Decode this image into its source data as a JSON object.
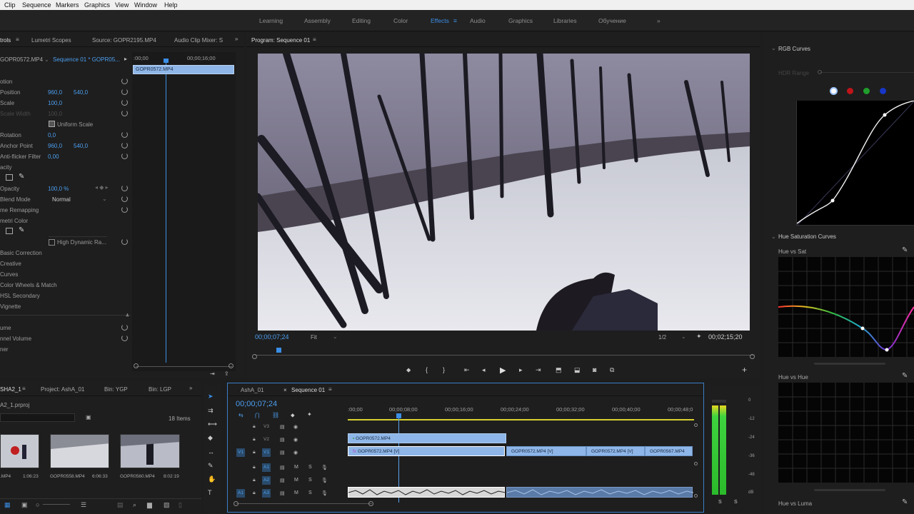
{
  "menu": [
    "Clip",
    "Sequence",
    "Markers",
    "Graphics",
    "View",
    "Window",
    "Help"
  ],
  "workspaces": [
    "Learning",
    "Assembly",
    "Editing",
    "Color",
    "Effects",
    "Audio",
    "Graphics",
    "Libraries",
    "Обучение"
  ],
  "active_workspace": "Effects",
  "overflow_glyph": "»",
  "effect_controls": {
    "tab": "trols",
    "tabs": [
      "Lumetri Scopes",
      "Source: GOPR2195.MP4",
      "Audio Clip Mixer: S"
    ],
    "source": "GOPR0572.MP4",
    "sequence_label": "Sequence 01 * GOPR05...",
    "time_start": ":00;00",
    "time_mid": "00;00;16;00",
    "clip_name": "GOPR0572.MP4",
    "rows": [
      {
        "label": "otion",
        "v1": "",
        "v2": ""
      },
      {
        "label": "Position",
        "v1": "960,0",
        "v2": "540,0"
      },
      {
        "label": "Scale",
        "v1": "100,0",
        "v2": ""
      },
      {
        "label": "Scale Width",
        "v1": "100,0",
        "v2": ""
      },
      {
        "label": "Uniform Scale",
        "v1": "",
        "v2": ""
      },
      {
        "label": "Rotation",
        "v1": "0,0",
        "v2": ""
      },
      {
        "label": "Anchor Point",
        "v1": "960,0",
        "v2": "540,0"
      },
      {
        "label": "Anti-flicker Filter",
        "v1": "0,00",
        "v2": ""
      },
      {
        "label": "acity",
        "v1": "",
        "v2": ""
      },
      {
        "label": "Opacity",
        "v1": "100,0 %",
        "v2": ""
      },
      {
        "label": "Blend Mode",
        "v1": "Normal",
        "v2": ""
      },
      {
        "label": "me Remapping",
        "v1": "",
        "v2": ""
      },
      {
        "label": "metri Color",
        "v1": "",
        "v2": ""
      },
      {
        "label": "High Dynamic Ra...",
        "v1": "",
        "v2": ""
      },
      {
        "label": "Basic Correction",
        "v1": "",
        "v2": ""
      },
      {
        "label": "Creative",
        "v1": "",
        "v2": ""
      },
      {
        "label": "Curves",
        "v1": "",
        "v2": ""
      },
      {
        "label": "Color Wheels & Match",
        "v1": "",
        "v2": ""
      },
      {
        "label": "HSL Secondary",
        "v1": "",
        "v2": ""
      },
      {
        "label": "Vignette",
        "v1": "",
        "v2": ""
      },
      {
        "label": "ume",
        "v1": "",
        "v2": ""
      },
      {
        "label": "nnel Volume",
        "v1": "",
        "v2": ""
      },
      {
        "label": "ner",
        "v1": "",
        "v2": ""
      }
    ]
  },
  "program": {
    "title": "Program: Sequence 01",
    "timecode": "00;00;07;24",
    "fit": "Fit",
    "resolution": "1/2",
    "duration": "00;02;15;20"
  },
  "project": {
    "tabs": [
      "SHA2_1",
      "Project: AshA_01",
      "Bin: YGP",
      "Bin: LGP"
    ],
    "file": "A2_1.prproj",
    "items_count": "18 Items",
    "thumbs": [
      {
        "name": ".MP4",
        "dur": "1:06:23"
      },
      {
        "name": "GOPR0558.MP4",
        "dur": "6:06:33"
      },
      {
        "name": "GOPR0560.MP4",
        "dur": "8:02:19"
      }
    ]
  },
  "timeline": {
    "tabs": [
      "AshA_01",
      "Sequence 01"
    ],
    "timecode": "00;00;07;24",
    "ticks": [
      ":00;00",
      "00;00;08;00",
      "00;00;16;00",
      "00;00;24;00",
      "00;00;32;00",
      "00;00;40;00",
      "00;00;48;0"
    ],
    "video_tracks": [
      "V3",
      "V2",
      "V1"
    ],
    "audio_tracks": [
      "A1",
      "A2",
      "A3"
    ],
    "source_patch_v": "V1",
    "source_patch_a": "A1",
    "track_toggle_m": "M",
    "track_toggle_s": "S",
    "clips": [
      {
        "label": "GOPR0572.MP4",
        "track": "V2"
      },
      {
        "label": "GOPR0572.MP4 [V]",
        "track": "V1"
      },
      {
        "label": "GOPR0572.MP4 [V]",
        "track": "V1"
      },
      {
        "label": "GOPR0572.MP4 [V]",
        "track": "V1"
      },
      {
        "label": "GOPR0567.MP4",
        "track": "V1"
      }
    ]
  },
  "meter": {
    "scale": [
      "0",
      "-12",
      "-24",
      "-36",
      "-48",
      "dB"
    ],
    "solo": [
      "S",
      "S"
    ]
  },
  "lumetri": {
    "rgb_curves": "RGB Curves",
    "hdr_range": "HDR Range",
    "hue_sat_curves": "Hue Saturation Curves",
    "hue_vs_sat": "Hue vs Sat",
    "hue_vs_hue": "Hue vs Hue",
    "hue_vs_luma": "Hue vs Luma",
    "channel_colors": [
      "#ffffff",
      "#c0141a",
      "#1f9e2c",
      "#1836c8"
    ]
  }
}
